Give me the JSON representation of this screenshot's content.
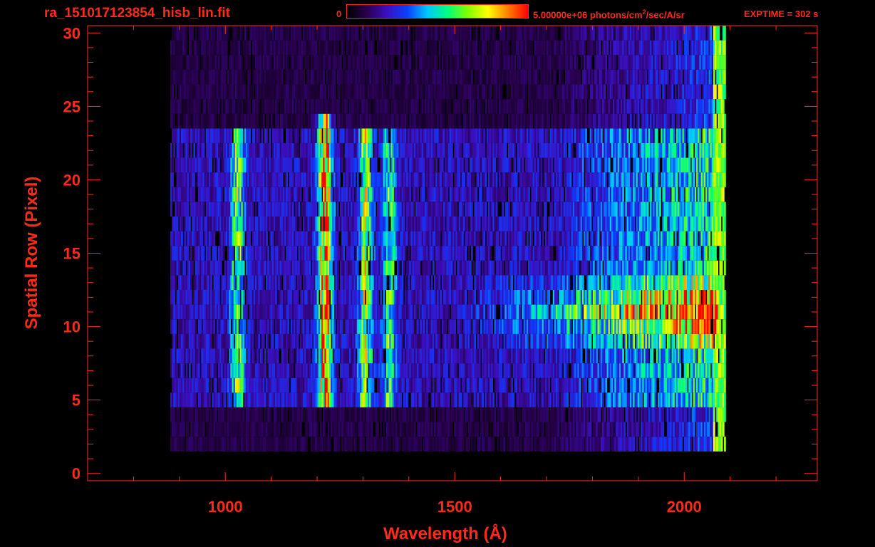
{
  "header": {
    "filename": "ra_151017123854_hisb_lin.fit",
    "colorbar_min_label": "0",
    "colorbar_max_label": "5.00000e+06 photons/cm",
    "colorbar_units_sup": "2",
    "colorbar_units_tail": "/sec/A/sr",
    "exptime_label": "EXPTIME = 302 s"
  },
  "colors": {
    "axis": "#ff2a1a",
    "background": "#000000",
    "colormap": [
      "#000000",
      "#2a0050",
      "#3a10c0",
      "#0a40ff",
      "#00c8ff",
      "#00ff80",
      "#80ff00",
      "#ffff00",
      "#ff8000",
      "#ff0000"
    ]
  },
  "chart_data": {
    "type": "heatmap",
    "xlabel": "Wavelength (Å)",
    "ylabel": "Spatial Row (Pixel)",
    "xlim": [
      700,
      2290
    ],
    "ylim": [
      -0.5,
      30.5
    ],
    "x_ticks": [
      1000,
      1500,
      2000
    ],
    "y_ticks": [
      0,
      5,
      10,
      15,
      20,
      25,
      30
    ],
    "value_range": [
      0,
      5000000
    ],
    "value_units": "photons/cm^2/sec/A/sr",
    "data_x_range": [
      880,
      2090
    ],
    "data_y_range": [
      2,
      30
    ],
    "slit_rows": [
      5,
      23
    ],
    "emission_lines": [
      {
        "wavelength": 1025,
        "rows": [
          5,
          23
        ],
        "level": 0.4
      },
      {
        "wavelength": 1216,
        "rows": [
          5,
          24
        ],
        "level": 0.7
      },
      {
        "wavelength": 1304,
        "rows": [
          5,
          23
        ],
        "level": 0.45
      },
      {
        "wavelength": 1356,
        "rows": [
          5,
          23
        ],
        "level": 0.35
      }
    ],
    "bright_band": {
      "rows": [
        9,
        13
      ],
      "x_range": [
        1500,
        2070
      ],
      "peak_level": 0.85
    },
    "continuum_rise_x": [
      1700,
      2070
    ]
  }
}
